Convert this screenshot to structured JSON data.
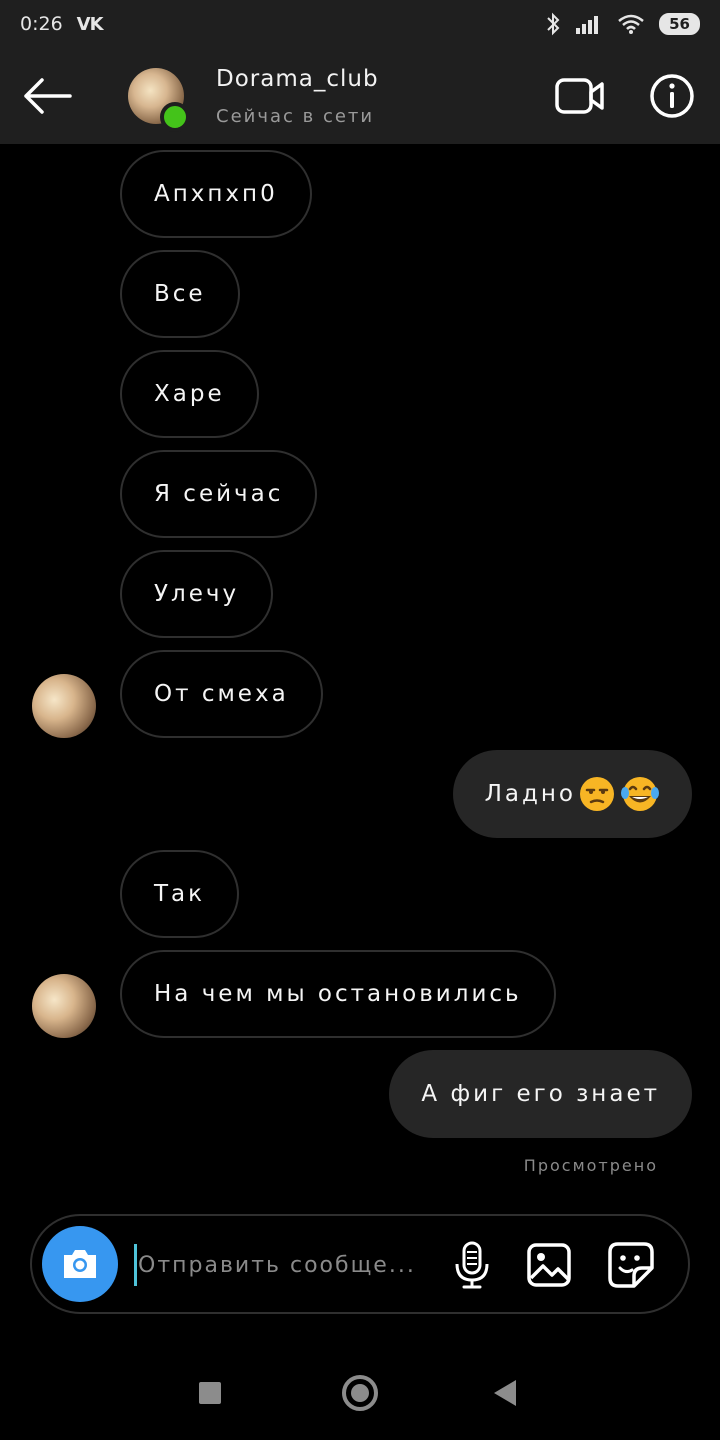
{
  "status_bar": {
    "time": "0:26",
    "vk_label": "VK",
    "battery": "56"
  },
  "header": {
    "title": "Dorama_club",
    "status": "Сейчас в сети"
  },
  "messages": [
    {
      "text": "Апхпхп0"
    },
    {
      "text": "Все"
    },
    {
      "text": "Харе"
    },
    {
      "text": "Я сейчас"
    },
    {
      "text": "Улечу"
    },
    {
      "text": "От смеха"
    },
    {
      "text": "Ладно",
      "emojis": [
        "unamused-face",
        "face-with-tears-of-joy"
      ]
    },
    {
      "text": "Так"
    },
    {
      "text": "На чем мы остановились"
    },
    {
      "text": "А фиг его знает"
    }
  ],
  "seen_label": "Просмотрено",
  "composer": {
    "placeholder": "Отправить сообще..."
  },
  "colors": {
    "background": "#000000",
    "header": "#1f1f1f",
    "outgoing_bubble": "#262626",
    "online": "#44c31a",
    "camera_button": "#3797f0"
  }
}
